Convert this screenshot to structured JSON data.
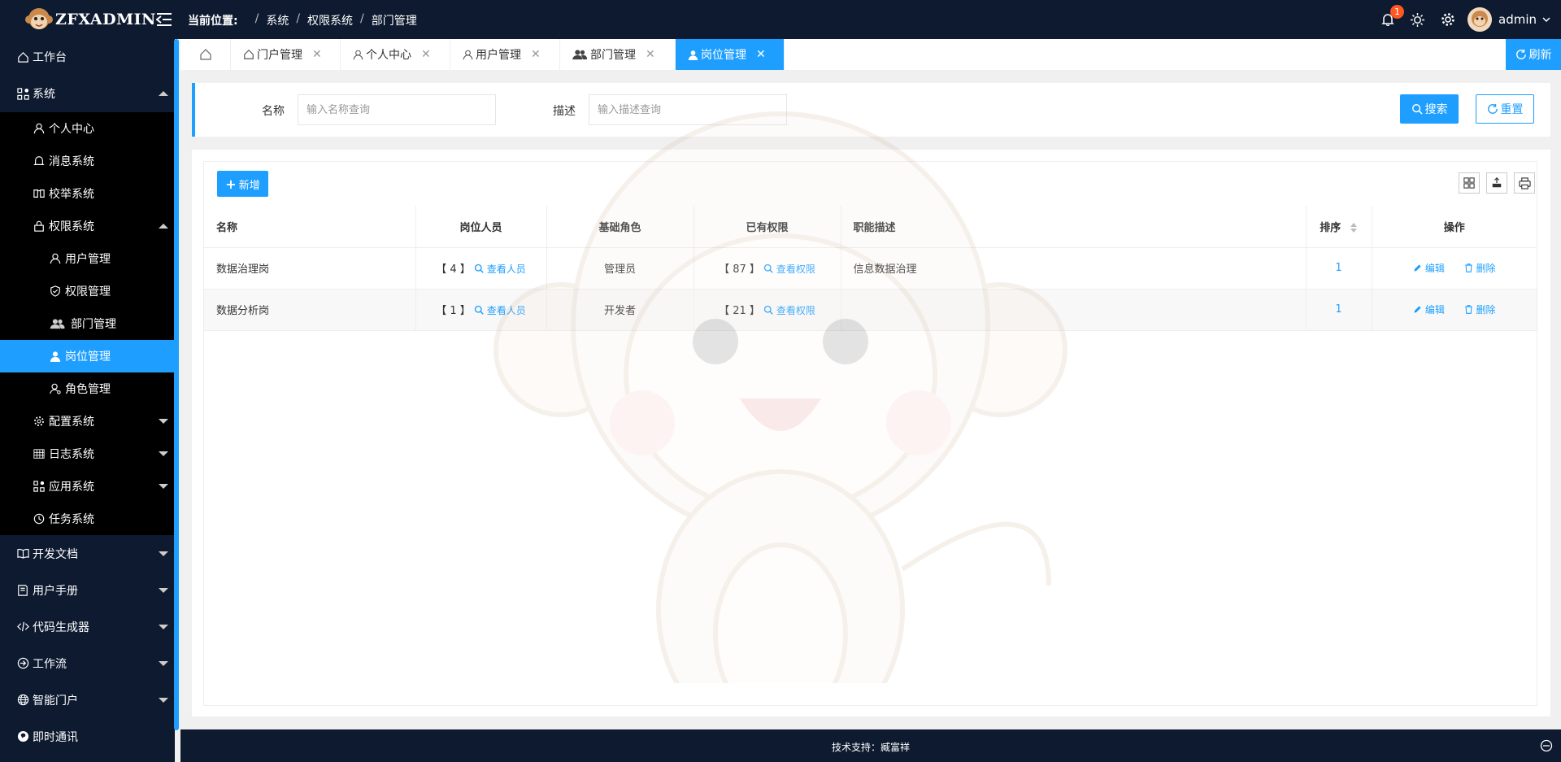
{
  "header": {
    "logo_text": "ZFXADMIN",
    "breadcrumb_label": "当前位置:",
    "breadcrumb": [
      "系统",
      "权限系统",
      "部门管理"
    ],
    "notification_count": "1",
    "username": "admin"
  },
  "sidebar": {
    "items": [
      {
        "label": "工作台",
        "icon": "home-icon"
      },
      {
        "label": "系统",
        "icon": "apps-icon"
      },
      {
        "label": "个人中心",
        "icon": "user-icon"
      },
      {
        "label": "消息系统",
        "icon": "bell-icon"
      },
      {
        "label": "校举系统",
        "icon": "book-icon"
      },
      {
        "label": "权限系统",
        "icon": "lock-icon"
      },
      {
        "label": "用户管理",
        "icon": "user-icon"
      },
      {
        "label": "权限管理",
        "icon": "shield-icon"
      },
      {
        "label": "部门管理",
        "icon": "users-icon"
      },
      {
        "label": "岗位管理",
        "icon": "user-solid-icon"
      },
      {
        "label": "角色管理",
        "icon": "role-icon"
      },
      {
        "label": "配置系统",
        "icon": "gear-icon"
      },
      {
        "label": "日志系统",
        "icon": "grid-icon"
      },
      {
        "label": "应用系统",
        "icon": "apps-icon"
      },
      {
        "label": "任务系统",
        "icon": "clock-icon"
      },
      {
        "label": "开发文档",
        "icon": "book-open-icon"
      },
      {
        "label": "用户手册",
        "icon": "note-icon"
      },
      {
        "label": "代码生成器",
        "icon": "code-icon"
      },
      {
        "label": "工作流",
        "icon": "flow-icon"
      },
      {
        "label": "智能门户",
        "icon": "globe-icon"
      },
      {
        "label": "即时通讯",
        "icon": "chat-icon"
      }
    ]
  },
  "tabs": {
    "items": [
      "门户管理",
      "个人中心",
      "用户管理",
      "部门管理",
      "岗位管理"
    ],
    "refresh_label": "刷新"
  },
  "search": {
    "name_label": "名称",
    "name_placeholder": "输入名称查询",
    "desc_label": "描述",
    "desc_placeholder": "输入描述查询",
    "search_button": "搜索",
    "reset_button": "重置"
  },
  "table": {
    "add_button": "新增",
    "columns": [
      "名称",
      "岗位人员",
      "基础角色",
      "已有权限",
      "职能描述",
      "排序",
      "操作"
    ],
    "rows": [
      {
        "name": "数据治理岗",
        "members": "【 4 】",
        "view_members": "查看人员",
        "role": "管理员",
        "perms": "【 87 】",
        "view_perms": "查看权限",
        "desc": "信息数据治理",
        "sort": "1",
        "edit": "编辑",
        "delete": "删除"
      },
      {
        "name": "数据分析岗",
        "members": "【 1 】",
        "view_members": "查看人员",
        "role": "开发者",
        "perms": "【 21 】",
        "view_perms": "查看权限",
        "desc": "",
        "sort": "1",
        "edit": "编辑",
        "delete": "删除"
      }
    ]
  },
  "footer": {
    "support_text": "技术支持：臧富祥"
  },
  "colors": {
    "primary": "#1e9fff",
    "dark": "#0d1a2f",
    "badge": "#ff5722"
  }
}
